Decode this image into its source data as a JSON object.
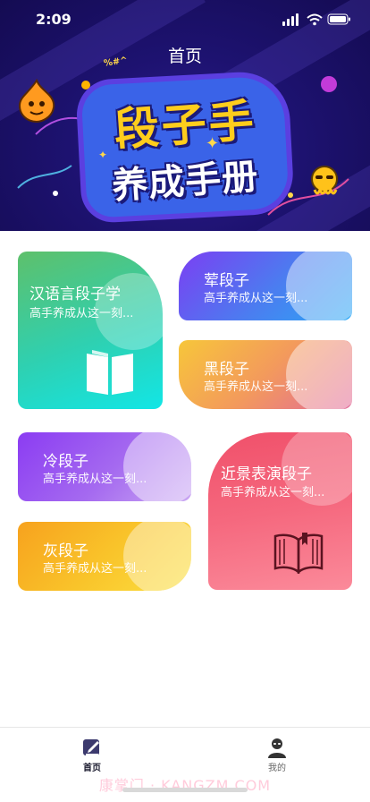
{
  "status_bar": {
    "time": "2:09"
  },
  "header": {
    "title": "首页"
  },
  "banner": {
    "logo_line1": "段子手",
    "logo_line2": "养成手册",
    "deco_text": "%#^"
  },
  "cards": [
    {
      "title": "汉语言段子学",
      "subtitle": "高手养成从这一刻..."
    },
    {
      "title": "荤段子",
      "subtitle": "高手养成从这一刻..."
    },
    {
      "title": "黑段子",
      "subtitle": "高手养成从这一刻..."
    },
    {
      "title": "冷段子",
      "subtitle": "高手养成从这一刻..."
    },
    {
      "title": "近景表演段子",
      "subtitle": "高手养成从这一刻..."
    },
    {
      "title": "灰段子",
      "subtitle": "高手养成从这一刻..."
    }
  ],
  "tabbar": {
    "items": [
      {
        "label": "首页",
        "icon": "edit-note-icon",
        "active": true
      },
      {
        "label": "我的",
        "icon": "user-icon",
        "active": false
      }
    ]
  },
  "watermark": "康掌门 · KANGZM.COM",
  "colors": {
    "tab_active": "#1a1a2e",
    "tab_inactive": "#666666"
  }
}
